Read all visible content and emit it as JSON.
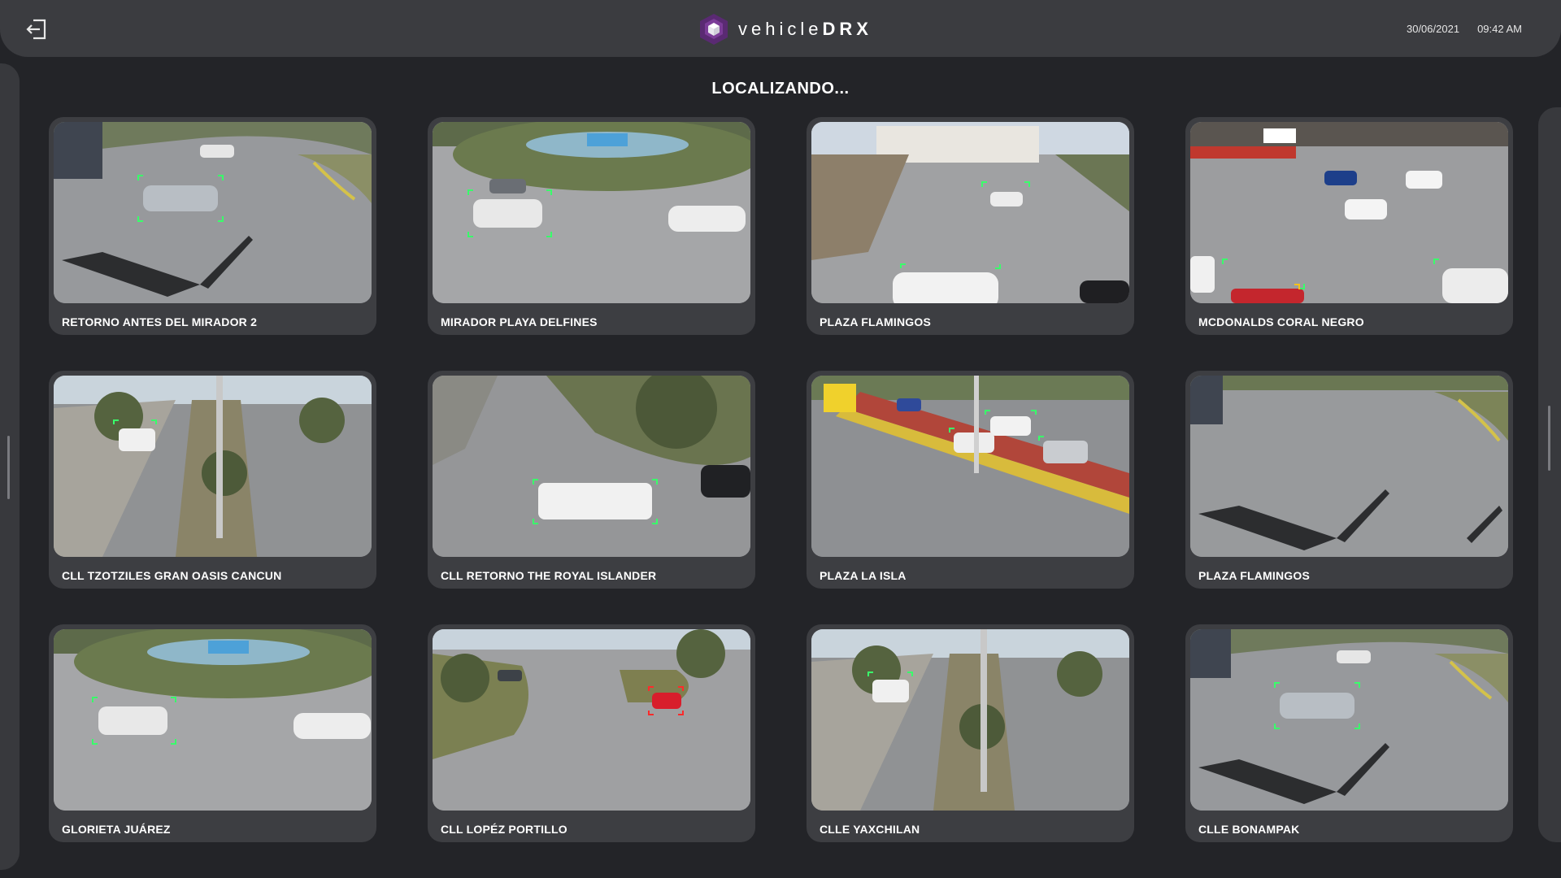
{
  "app": {
    "brand_prefix": "vehicle",
    "brand_suffix": "DRX",
    "date": "30/06/2021",
    "time": "09:42 AM",
    "logout_icon": "logout-icon",
    "accent_color": "#5a2a73"
  },
  "page": {
    "heading": "LOCALIZANDO..."
  },
  "cameras": [
    {
      "label": "RETORNO ANTES DEL MIRADOR 2"
    },
    {
      "label": "MIRADOR PLAYA DELFINES"
    },
    {
      "label": "PLAZA FLAMINGOS"
    },
    {
      "label": "MCDONALDS CORAL NEGRO"
    },
    {
      "label": "CLL TZOTZILES GRAN OASIS CANCUN"
    },
    {
      "label": "CLL RETORNO THE ROYAL ISLANDER"
    },
    {
      "label": "PLAZA LA ISLA"
    },
    {
      "label": "PLAZA FLAMINGOS"
    },
    {
      "label": "GLORIETA JUÁREZ"
    },
    {
      "label": "CLL LOPÉZ PORTILLO"
    },
    {
      "label": "CLLE YAXCHILAN"
    },
    {
      "label": "CLLE BONAMPAK"
    }
  ]
}
